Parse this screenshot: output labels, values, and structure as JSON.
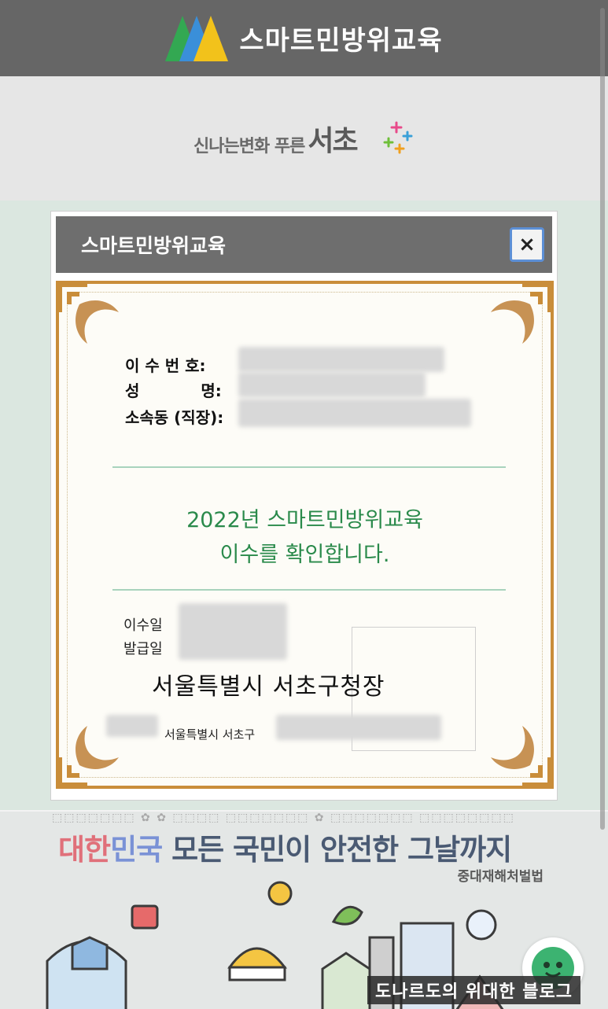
{
  "header": {
    "title": "스마트민방위교육",
    "logo_icon": "triangle-logo-icon"
  },
  "slogan": {
    "small_text": "신나는변화 푸른",
    "big_text": "서초"
  },
  "modal": {
    "title": "스마트민방위교육",
    "close_label": "×",
    "certificate": {
      "number_label": "이 수 번 호:",
      "name_label_1": "성",
      "name_label_2": "명:",
      "org_label": "소속동 (직장):",
      "confirm_line1": "2022년 스마트민방위교육",
      "confirm_line2": "이수를 확인합니다.",
      "completion_date_label": "이수일",
      "issue_date_label": "발급일",
      "issuer": "서울특별시 서초구청장",
      "address": "서울특별시 서초구"
    }
  },
  "banner": {
    "headline_part1": "대한",
    "headline_part2": "민국",
    "headline_part3": " 모든 국민이 안전한 그날까지",
    "subtitle": "중대재해처벌법"
  },
  "watermark": "도나르도의 위대한 블로그",
  "colors": {
    "header_bg": "#666666",
    "modal_header_bg": "#6e6e6e",
    "confirm_text": "#2a8a4b",
    "cert_border": "#c98d3a",
    "close_border": "#5c8fd6"
  }
}
